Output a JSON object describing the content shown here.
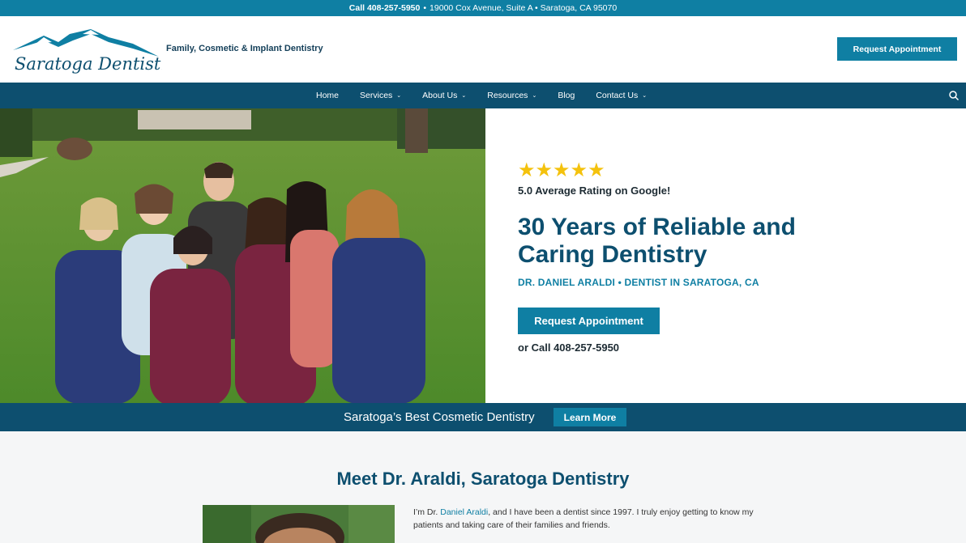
{
  "topbar": {
    "phone": "Call 408-257-5950",
    "separator": "•",
    "address": "19000 Cox Avenue, Suite A • Saratoga, CA 95070"
  },
  "header": {
    "logo_text": "Saratoga Dentistry",
    "tagline": "Family, Cosmetic & Implant Dentistry",
    "cta": "Request Appointment"
  },
  "nav": {
    "items": [
      {
        "label": "Home",
        "dropdown": false
      },
      {
        "label": "Services",
        "dropdown": true
      },
      {
        "label": "About Us",
        "dropdown": true
      },
      {
        "label": "Resources",
        "dropdown": true
      },
      {
        "label": "Blog",
        "dropdown": false
      },
      {
        "label": "Contact Us",
        "dropdown": true
      }
    ],
    "chevron": "⌄",
    "search_icon": "search-icon"
  },
  "hero": {
    "stars": "★★★★★",
    "rating": "5.0 Average Rating on Google!",
    "title": "30 Years of Reliable and Caring Dentistry",
    "subtitle": "DR. DANIEL ARALDI • DENTIST IN SARATOGA, CA",
    "cta": "Request Appointment",
    "call": "or Call 408-257-5950"
  },
  "strip": {
    "text": "Saratoga’s Best Cosmetic Dentistry",
    "cta": "Learn More"
  },
  "meet": {
    "title": "Meet Dr. Araldi, Saratoga Dentistry",
    "text_before": "I’m Dr. ",
    "text_link": "Daniel Araldi",
    "text_after": ", and I have been a dentist since 1997. I truly enjoy getting to know my patients and taking care of their families and friends."
  },
  "colors": {
    "primary": "#0f7fa3",
    "nav": "#0d4f6f",
    "star": "#f4c20d"
  }
}
